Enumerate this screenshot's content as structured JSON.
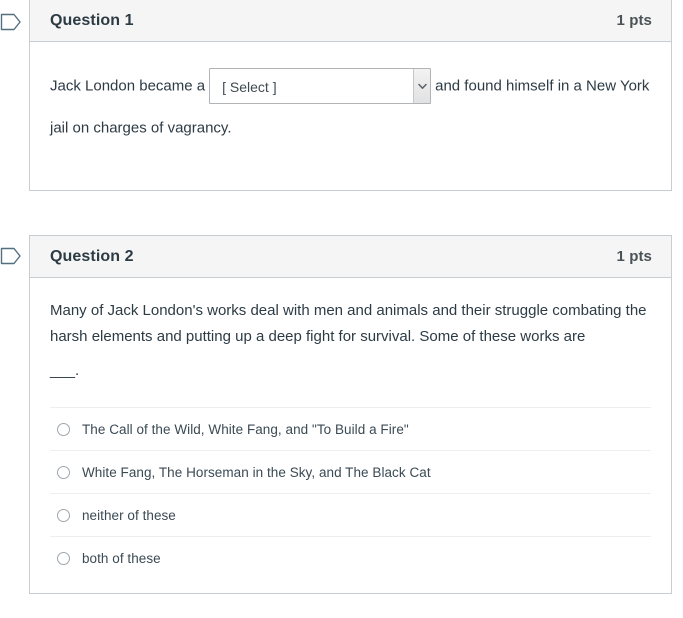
{
  "questions": [
    {
      "flag_icon": "flag-bookmark-icon",
      "title": "Question 1",
      "points": "1 pts",
      "type": "dropdown",
      "prompt_before": "Jack London became a",
      "prompt_after": "and found himself in a New York jail on charges of vagrancy.",
      "select": {
        "value": "[ Select ]",
        "arrow_icon": "chevron-down-icon",
        "options": [
          "[ Select ]"
        ]
      }
    },
    {
      "flag_icon": "flag-bookmark-icon",
      "title": "Question 2",
      "points": "1 pts",
      "type": "multiple-choice",
      "prompt": "Many of Jack London's works deal with men and animals and their struggle combating the harsh elements and putting up a deep fight for survival. Some of these works are",
      "blank": "___.",
      "options": [
        {
          "label": "The Call of the Wild, White Fang, and \"To Build a Fire\"",
          "selected": false
        },
        {
          "label": "White Fang, The Horseman in the Sky, and The Black Cat",
          "selected": false
        },
        {
          "label": "neither of these",
          "selected": false
        },
        {
          "label": "both of these",
          "selected": false
        }
      ]
    }
  ],
  "colors": {
    "card_border": "#c7cdd1",
    "header_bg": "#f5f5f5",
    "title_text": "#2d3b45",
    "body_text": "#2d3b45",
    "flag_outline": "#54707f",
    "divider": "#eceff1"
  }
}
